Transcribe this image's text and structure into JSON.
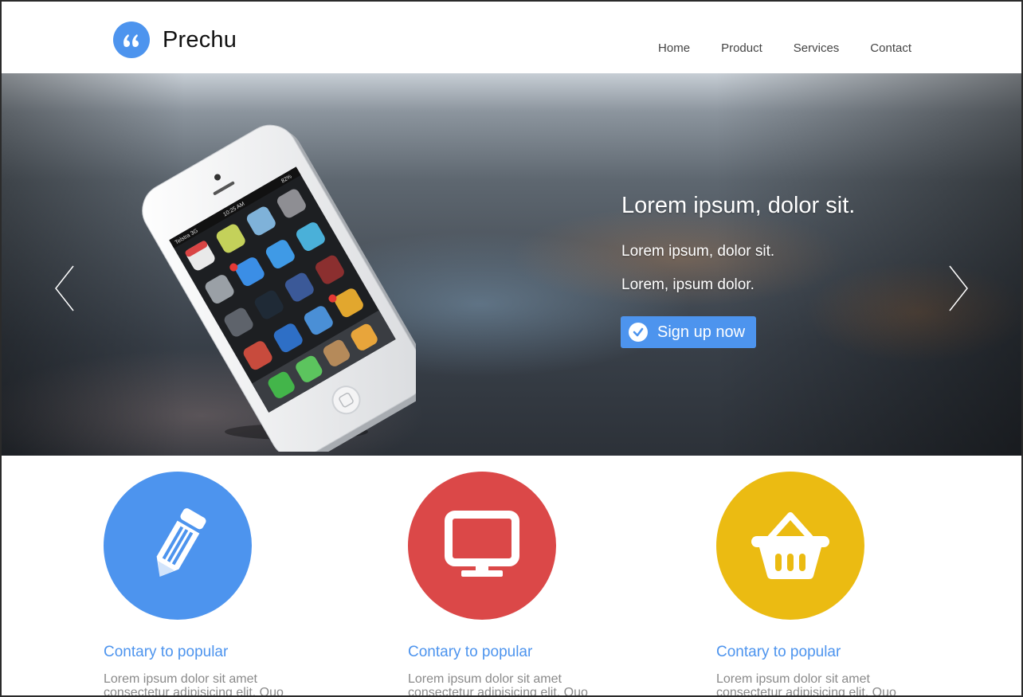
{
  "brand": {
    "name": "Prechu",
    "logo_glyph": "“",
    "accent": "#4d94ee"
  },
  "nav": {
    "items": [
      {
        "label": "Home"
      },
      {
        "label": "Product"
      },
      {
        "label": "Services"
      },
      {
        "label": "Contact"
      }
    ]
  },
  "hero": {
    "title": "Lorem ipsum, dolor sit.",
    "line1": "Lorem ipsum, dolor sit.",
    "line2": "Lorem, ipsum dolor.",
    "cta_label": "Sign up now",
    "prev_icon": "chevron-left-icon",
    "next_icon": "chevron-right-icon"
  },
  "phone": {
    "carrier": "Telstra 3G",
    "time": "10:25 AM",
    "battery": "82%"
  },
  "features": [
    {
      "icon": "pencil-icon",
      "color": "#4d94ee",
      "title": "Contary to popular",
      "text": "Lorem ipsum dolor sit amet consectetur adipisicing elit. Quo"
    },
    {
      "icon": "monitor-icon",
      "color": "#db4848",
      "title": "Contary to popular",
      "text": "Lorem ipsum dolor sit amet consectetur adipisicing elit. Quo"
    },
    {
      "icon": "basket-icon",
      "color": "#ebbb12",
      "title": "Contary to popular",
      "text": "Lorem ipsum dolor sit amet consectetur adipisicing elit. Quo"
    }
  ]
}
